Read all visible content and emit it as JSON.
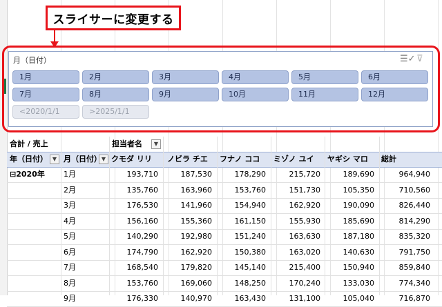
{
  "callout": {
    "text": "スライサーに変更する"
  },
  "slicer": {
    "title": "月（日付）",
    "icons": {
      "multi_select": "multi-select-icon",
      "clear_filter": "clear-filter-icon"
    },
    "items": [
      "1月",
      "2月",
      "3月",
      "4月",
      "5月",
      "6月",
      "7月",
      "8月",
      "9月",
      "10月",
      "11月",
      "12月",
      "<2020/1/1",
      ">2025/1/1"
    ],
    "disabled": [
      "<2020/1/1",
      ">2025/1/1"
    ]
  },
  "pivot": {
    "value_label": "合計 / 売上",
    "column_field": "担当者名",
    "row_field_year": "年（日付）",
    "row_field_month": "月（日付）",
    "columns": [
      "クモダ リリ",
      "ノビラ チエ",
      "フナノ ココ",
      "ミゾノ ユイ",
      "ヤギシ マロ",
      "総計"
    ],
    "year_group": {
      "label": "2020年",
      "toggle": "⊟"
    },
    "rows": [
      {
        "month": "1月",
        "values": [
          "193,710",
          "187,530",
          "178,290",
          "215,720",
          "189,690",
          "964,940"
        ]
      },
      {
        "month": "2月",
        "values": [
          "135,760",
          "163,960",
          "153,760",
          "151,730",
          "105,350",
          "710,560"
        ]
      },
      {
        "month": "3月",
        "values": [
          "176,530",
          "141,960",
          "154,940",
          "162,920",
          "190,090",
          "826,440"
        ]
      },
      {
        "month": "4月",
        "values": [
          "156,160",
          "155,360",
          "161,150",
          "155,930",
          "185,690",
          "814,290"
        ]
      },
      {
        "month": "5月",
        "values": [
          "140,290",
          "192,980",
          "151,240",
          "163,630",
          "187,180",
          "835,320"
        ]
      },
      {
        "month": "6月",
        "values": [
          "174,790",
          "162,920",
          "150,380",
          "163,020",
          "140,630",
          "791,750"
        ]
      },
      {
        "month": "7月",
        "values": [
          "168,540",
          "179,820",
          "145,140",
          "215,400",
          "150,940",
          "859,840"
        ]
      },
      {
        "month": "8月",
        "values": [
          "153,760",
          "169,060",
          "148,250",
          "170,240",
          "133,030",
          "774,340"
        ]
      },
      {
        "month": "9月",
        "values": [
          "176,330",
          "140,970",
          "163,430",
          "131,100",
          "105,040",
          "716,870"
        ]
      }
    ]
  }
}
